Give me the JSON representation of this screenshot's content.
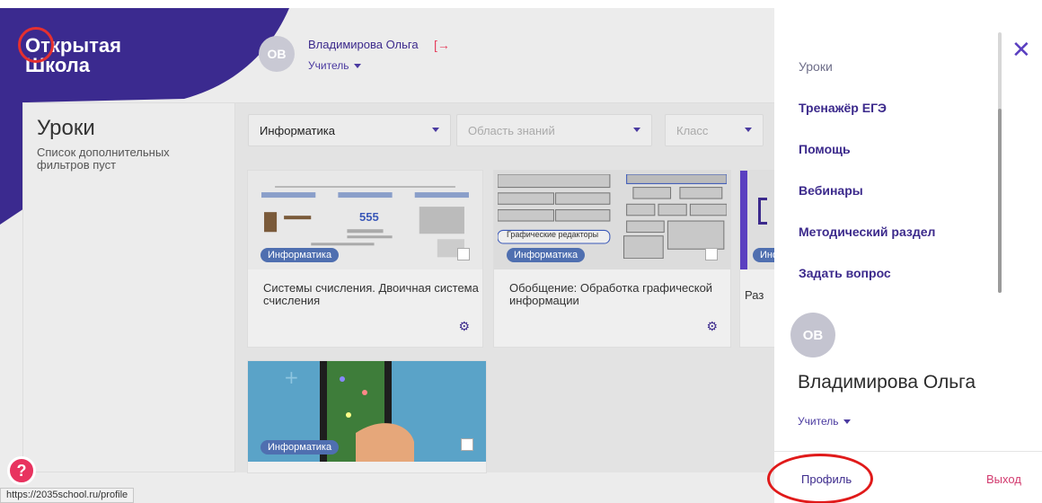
{
  "app": {
    "logo_line1": "Открытая",
    "logo_line2": "Школа",
    "user_initials": "ОВ",
    "user_name": "Владимирова Ольга",
    "user_role": "Учитель",
    "accent_color": "#3b2a8f"
  },
  "sidebar": {
    "title": "Уроки",
    "subtitle": "Список дополнительных фильтров пуст"
  },
  "filters": {
    "subject": "Информатика",
    "area_placeholder": "Область знаний",
    "class_placeholder": "Класс"
  },
  "cards": [
    {
      "badge": "Информатика",
      "title": "Системы счисления. Двоичная система счисления",
      "thumb_number": "555"
    },
    {
      "badge": "Информатика",
      "title": "Обобщение: Обработка графической информации",
      "thumb_label": "Графические редакторы"
    },
    {
      "badge": "Информатика",
      "title": "Раз"
    },
    {
      "badge": "Информатика",
      "title": ""
    }
  ],
  "drawer": {
    "menu": [
      "Уроки",
      "Тренажёр ЕГЭ",
      "Помощь",
      "Вебинары",
      "Методический раздел",
      "Задать вопрос"
    ],
    "user_initials": "ОВ",
    "user_name": "Владимирова Ольга",
    "user_role": "Учитель",
    "profile_label": "Профиль",
    "logout_label": "Выход"
  },
  "status_url": "https://2035school.ru/profile",
  "help_symbol": "?"
}
